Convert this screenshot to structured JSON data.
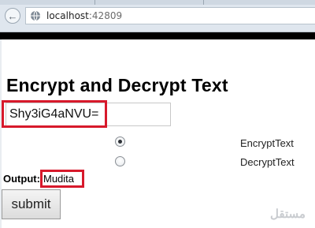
{
  "browser": {
    "url_host": "localhost",
    "url_port": ":42809"
  },
  "page": {
    "title": "Encrypt and Decrypt Text",
    "input_value": "Shy3iG4aNVU=",
    "radio_options": [
      {
        "label": "EncryptText",
        "checked": true
      },
      {
        "label": "DecryptText",
        "checked": false
      }
    ],
    "output_label": "Output:",
    "output_value": "Mudita",
    "submit_label": "submit"
  },
  "colors": {
    "highlight": "#d7192b",
    "top_band": "#000000"
  },
  "watermark": "مستقل"
}
